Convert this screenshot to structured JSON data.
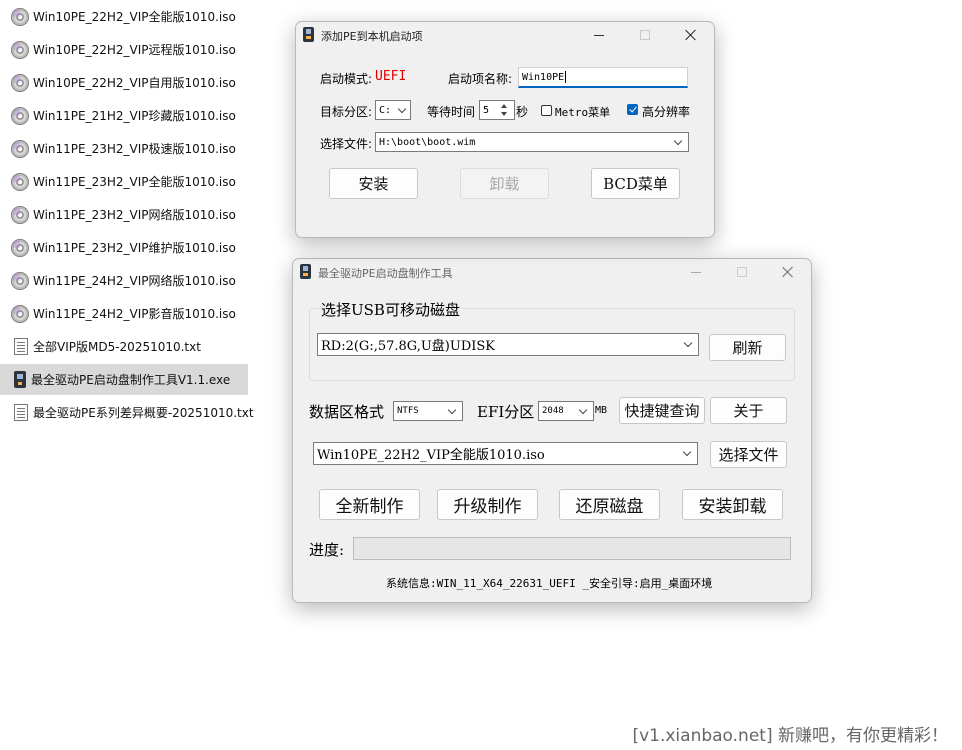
{
  "files": [
    {
      "name": "Win10PE_22H2_VIP全能版1010.iso",
      "type": "iso"
    },
    {
      "name": "Win10PE_22H2_VIP远程版1010.iso",
      "type": "iso"
    },
    {
      "name": "Win10PE_22H2_VIP自用版1010.iso",
      "type": "iso"
    },
    {
      "name": "Win11PE_21H2_VIP珍藏版1010.iso",
      "type": "iso"
    },
    {
      "name": "Win11PE_23H2_VIP极速版1010.iso",
      "type": "iso"
    },
    {
      "name": "Win11PE_23H2_VIP全能版1010.iso",
      "type": "iso"
    },
    {
      "name": "Win11PE_23H2_VIP网络版1010.iso",
      "type": "iso"
    },
    {
      "name": "Win11PE_23H2_VIP维护版1010.iso",
      "type": "iso"
    },
    {
      "name": "Win11PE_24H2_VIP网络版1010.iso",
      "type": "iso"
    },
    {
      "name": "Win11PE_24H2_VIP影音版1010.iso",
      "type": "iso"
    },
    {
      "name": "全部VIP版MD5-20251010.txt",
      "type": "txt"
    },
    {
      "name": "最全驱动PE启动盘制作工具V1.1.exe",
      "type": "exe",
      "selected": true
    },
    {
      "name": "最全驱动PE系列差异概要-20251010.txt",
      "type": "txt"
    }
  ],
  "dialog": {
    "title": "添加PE到本机启动项",
    "boot_mode_label": "启动模式:",
    "boot_mode_value": "UEFI",
    "boot_mode_color": "#e00000",
    "boot_name_label": "启动项名称:",
    "boot_name_value": "Win10PE",
    "target_partition_label": "目标分区:",
    "target_partition_value": "C:",
    "wait_time_label": "等待时间",
    "wait_time_value": "5",
    "wait_time_unit": "秒",
    "metro_label": "Metro菜单",
    "metro_checked": false,
    "hidpi_label": "高分辨率",
    "hidpi_checked": true,
    "file_label": "选择文件:",
    "file_value": "H:\\boot\\boot.wim",
    "install_btn": "安装",
    "uninstall_btn": "卸载",
    "bcd_btn": "BCD菜单"
  },
  "main": {
    "title": "最全驱动PE启动盘制作工具",
    "usb_group_label": "选择USB可移动磁盘",
    "usb_value": "RD:2(G:,57.8G,U盘)UDISK",
    "refresh_btn": "刷新",
    "data_format_label": "数据区格式",
    "data_format_value": "NTFS",
    "efi_label": "EFI分区",
    "efi_value": "2048",
    "efi_unit": "MB",
    "shortcut_btn": "快捷键查询",
    "about_btn": "关于",
    "iso_value": "Win10PE_22H2_VIP全能版1010.iso",
    "choose_file_btn": "选择文件",
    "new_make_btn": "全新制作",
    "upgrade_btn": "升级制作",
    "restore_btn": "还原磁盘",
    "install_uninstall_btn": "安装卸载",
    "progress_label": "进度:",
    "progress_value": 0,
    "system_info_label": "系统信息:",
    "system_info_value": "WIN_11_X64_22631_UEFI _安全引导:启用_桌面环境"
  },
  "watermark": "[v1.xianbao.net] 新赚吧，有你更精彩！"
}
